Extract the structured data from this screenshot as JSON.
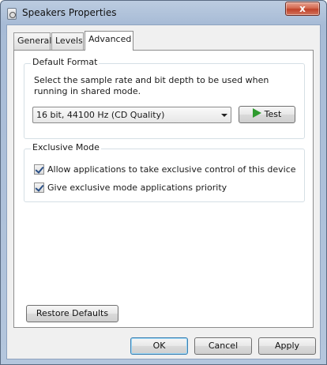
{
  "window": {
    "title": "Speakers Properties",
    "close_label": "x"
  },
  "tabs": [
    {
      "label": "General",
      "active": false
    },
    {
      "label": "Levels",
      "active": false
    },
    {
      "label": "Advanced",
      "active": true
    }
  ],
  "default_format": {
    "legend": "Default Format",
    "description": "Select the sample rate and bit depth to be used when running in shared mode.",
    "selected_format": "16 bit, 44100 Hz (CD Quality)",
    "test_label": "Test"
  },
  "exclusive_mode": {
    "legend": "Exclusive Mode",
    "options": [
      {
        "label": "Allow applications to take exclusive control of this device",
        "checked": true
      },
      {
        "label": "Give exclusive mode applications priority",
        "checked": true
      }
    ]
  },
  "buttons": {
    "restore_defaults": "Restore Defaults",
    "ok": "OK",
    "cancel": "Cancel",
    "apply": "Apply"
  },
  "colors": {
    "title_bar": "#a7bbd6",
    "close_button": "#c0432a",
    "test_play_icon": "#2e9a2e"
  }
}
